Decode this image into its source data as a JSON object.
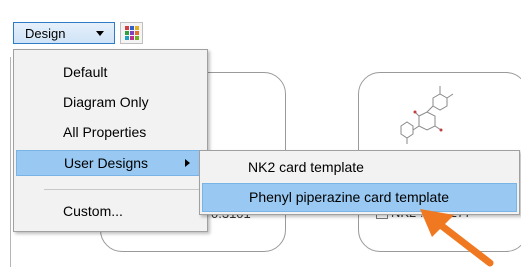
{
  "toolbar": {
    "design_label": "Design",
    "grid_colors": [
      "#d04040",
      "#3060d0",
      "#e0b020",
      "#30a040",
      "#8040c0",
      "#e07030",
      "#20a0c0",
      "#c03090",
      "#70b020"
    ]
  },
  "menu": {
    "items": [
      {
        "label": "Default"
      },
      {
        "label": "Diagram Only"
      },
      {
        "label": "All Properties"
      },
      {
        "label": "User Designs",
        "has_submenu": true,
        "highlighted": true
      },
      {
        "label": "Custom..."
      }
    ]
  },
  "submenu": {
    "items": [
      {
        "label": "NK2 card template"
      },
      {
        "label": "Phenyl piperazine card template",
        "highlighted": true
      }
    ]
  },
  "cards": {
    "left_value": "0.3101",
    "right_text": "NK2",
    "right_value": "0.277"
  },
  "colors": {
    "highlight": "#99c9f2",
    "pointer": "#f07820"
  }
}
